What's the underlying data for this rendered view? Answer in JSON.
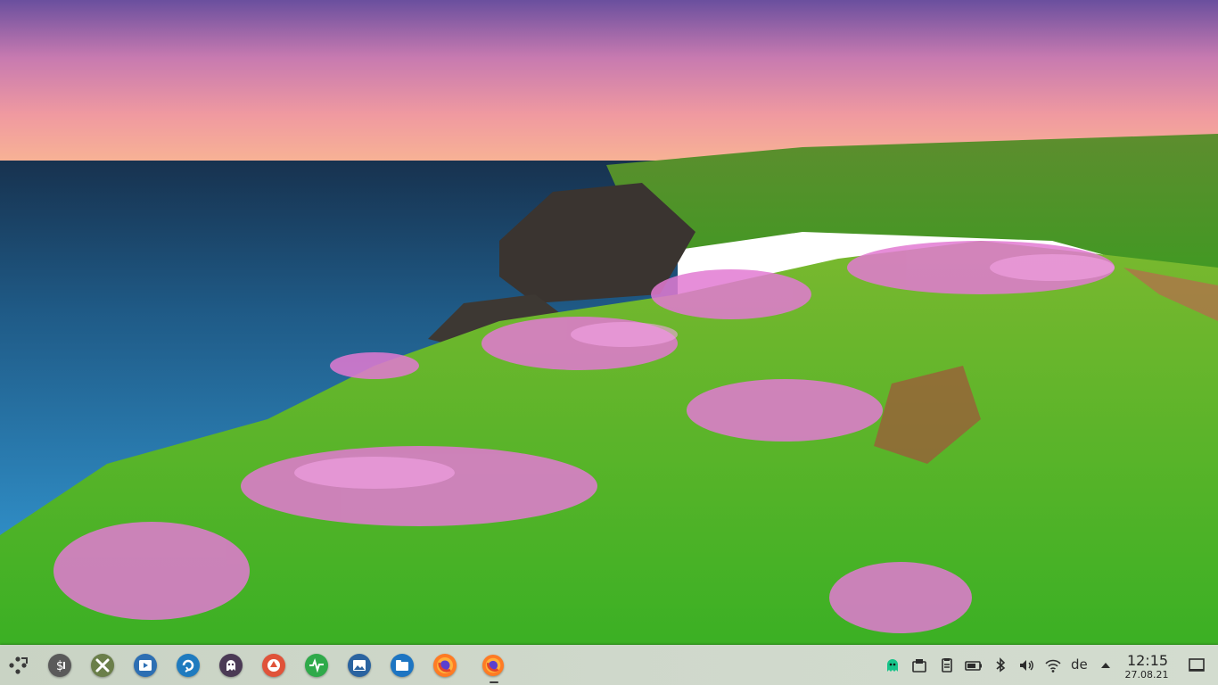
{
  "desktop": {
    "wallpaper": "coastal cliff with pink flowers at sunset"
  },
  "taskbar": {
    "launchers": [
      {
        "name": "application-menu-icon",
        "color": "#3a3a3a"
      },
      {
        "name": "terminal-icon",
        "color": "#5a5a5a"
      },
      {
        "name": "settings-tools-icon",
        "color": "#6b7f4a"
      },
      {
        "name": "video-player-icon",
        "color": "#2d6fb3"
      },
      {
        "name": "sync-icon",
        "color": "#1f7bbf"
      },
      {
        "name": "ghost-icon",
        "color": "#4b3a55"
      },
      {
        "name": "share-icon",
        "color": "#e0533a"
      },
      {
        "name": "system-monitor-icon",
        "color": "#2faa4a"
      },
      {
        "name": "image-viewer-icon",
        "color": "#2a63a0"
      },
      {
        "name": "file-manager-icon",
        "color": "#1d75c2"
      },
      {
        "name": "firefox-icon",
        "color": "#ff7b24"
      },
      {
        "name": "firefox-running-icon",
        "color": "#ff7b24"
      }
    ],
    "tray": {
      "keyboard_layout": "de",
      "clock_time": "12:15",
      "clock_date": "27.08.21"
    }
  }
}
